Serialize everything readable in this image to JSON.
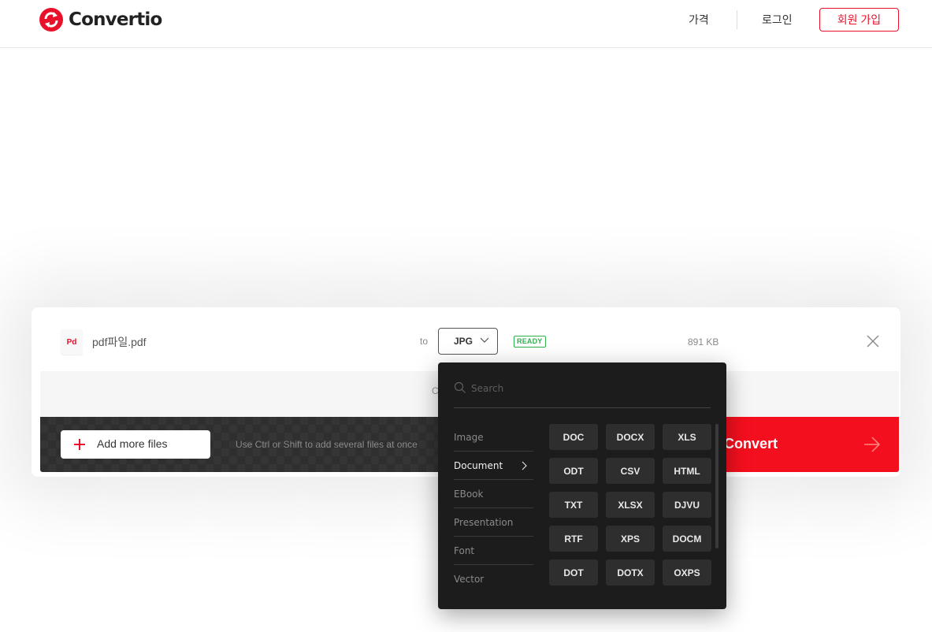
{
  "header": {
    "logo_text": "Convertio",
    "nav_pricing": "가격",
    "nav_login": "로그인",
    "nav_signup": "회원 가입",
    "brand_color": "#e8102a"
  },
  "file": {
    "badge": "Pd",
    "name": "pdf파일.pdf",
    "to_label": "to",
    "target_format": "JPG",
    "status": "READY",
    "size": "891 KB"
  },
  "options": {
    "text": "C"
  },
  "bottom_bar": {
    "add_files_label": "Add more files",
    "hint": "Use Ctrl or Shift to add several files at once",
    "convert_label": "Convert",
    "convert_color": "#f40f1e"
  },
  "dropdown": {
    "search_placeholder": "Search",
    "categories": [
      {
        "label": "Image",
        "active": false
      },
      {
        "label": "Document",
        "active": true
      },
      {
        "label": "EBook",
        "active": false
      },
      {
        "label": "Presentation",
        "active": false
      },
      {
        "label": "Font",
        "active": false
      },
      {
        "label": "Vector",
        "active": false
      }
    ],
    "formats": [
      "DOC",
      "DOCX",
      "XLS",
      "ODT",
      "CSV",
      "HTML",
      "TXT",
      "XLSX",
      "DJVU",
      "RTF",
      "XPS",
      "DOCM",
      "DOT",
      "DOTX",
      "OXPS"
    ]
  }
}
